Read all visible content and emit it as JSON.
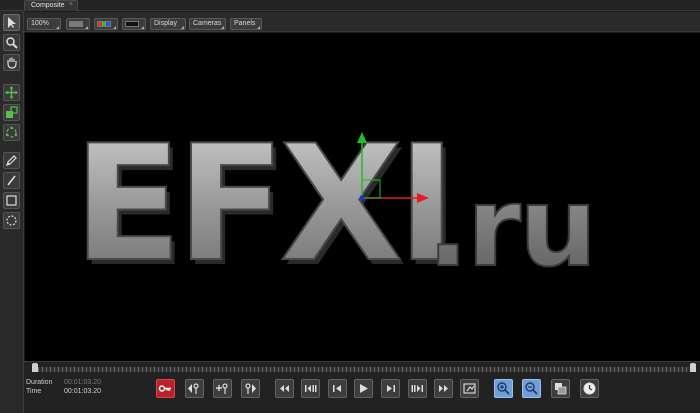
{
  "tabs": [
    {
      "label": "Composite",
      "close": "×"
    }
  ],
  "toolbar": {
    "zoom": "100%",
    "display_label": "Display",
    "cameras_label": "Cameras",
    "panels_label": "Panels"
  },
  "left_tools": [
    {
      "name": "select-arrow-icon",
      "active": true
    },
    {
      "name": "zoom-icon"
    },
    {
      "name": "hand-pan-icon"
    },
    {
      "name": "move-icon"
    },
    {
      "name": "scale-icon"
    },
    {
      "name": "rotate-icon"
    },
    {
      "name": "pen-icon"
    },
    {
      "name": "brush-icon"
    },
    {
      "name": "rectangle-mask-icon"
    },
    {
      "name": "ellipse-mask-icon"
    }
  ],
  "viewer": {
    "text_main": "EFXI",
    "text_suffix": ".ru",
    "background": "#000000",
    "text_color_main": "#a8a8a8",
    "text_color_suffix": "#8a8a8a",
    "gizmo_colors": {
      "x": "#e02020",
      "y": "#20c020",
      "z": "#2030e0"
    }
  },
  "timeline": {
    "playhead_fraction": 0.0
  },
  "transport": {
    "duration_label": "Duration",
    "duration_value": "00:01:03.20",
    "time_label": "Time",
    "time_value": "00:01:03.20",
    "buttons": [
      "key-icon",
      "previous-key-icon",
      "add-key-icon",
      "next-key-icon",
      "go-to-start-icon",
      "previous-frame-icon",
      "step-back-icon",
      "play-icon",
      "step-forward-icon",
      "next-frame-icon",
      "go-to-end-icon",
      "render-icon",
      "zoom-in-timeline-icon",
      "zoom-out-timeline-icon",
      "layers-icon",
      "clock-icon"
    ]
  },
  "colors": {
    "accent_red": "#b8232b",
    "accent_blue": "#6f9ed8"
  }
}
